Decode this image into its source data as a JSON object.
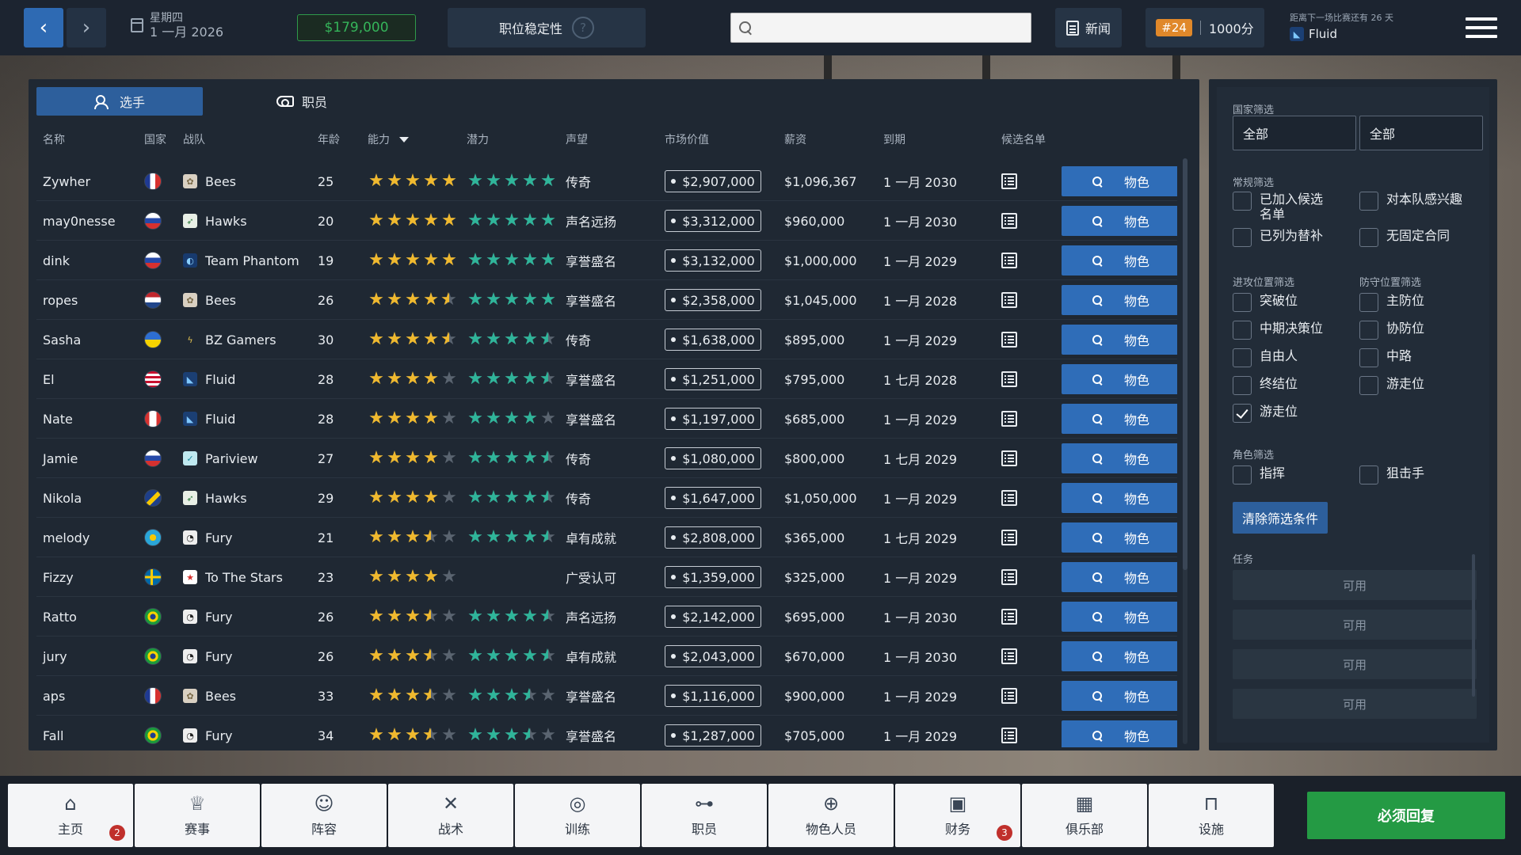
{
  "topbar": {
    "weekday": "星期四",
    "date": "1 一月 2026",
    "balance": "$179,000",
    "job_security_label": "职位稳定性",
    "job_security_help": "?",
    "search": {
      "value": "",
      "placeholder": ""
    },
    "news_label": "新闻",
    "rank_badge": "#24",
    "points": "1000分",
    "next_match_label": "距离下一场比赛还有 26 天",
    "next_match_team": "Fluid"
  },
  "tabs": [
    {
      "label": "选手",
      "icon": "players-icon",
      "active": true
    },
    {
      "label": "职员",
      "icon": "whistle-icon",
      "active": false
    }
  ],
  "table": {
    "headers": {
      "name": "名称",
      "nationality": "国家",
      "team": "战队",
      "age": "年龄",
      "ability": "能力",
      "potential": "潜力",
      "reputation": "声望",
      "market_value": "市场价值",
      "salary": "薪资",
      "expiry": "到期",
      "shortlist": "候选名单"
    },
    "scout_label": "物色",
    "rows": [
      {
        "name": "Zywher",
        "flag": "france",
        "team": "Bees",
        "age": "25",
        "ability": 5,
        "potential": 5,
        "reputation": "传奇",
        "value": "$2,907,000",
        "salary": "$1,096,367",
        "expiry": "1 一月 2030"
      },
      {
        "name": "may0nesse",
        "flag": "russia",
        "team": "Hawks",
        "age": "20",
        "ability": 5,
        "potential": 5,
        "reputation": "声名远扬",
        "value": "$3,312,000",
        "salary": "$960,000",
        "expiry": "1 一月 2030"
      },
      {
        "name": "dink",
        "flag": "russia",
        "team": "Team Phantom",
        "age": "19",
        "ability": 5,
        "potential": 5,
        "reputation": "享誉盛名",
        "value": "$3,132,000",
        "salary": "$1,000,000",
        "expiry": "1 一月 2029"
      },
      {
        "name": "ropes",
        "flag": "netherlands",
        "team": "Bees",
        "age": "26",
        "ability": 4.5,
        "potential": 5,
        "reputation": "享誉盛名",
        "value": "$2,358,000",
        "salary": "$1,045,000",
        "expiry": "1 一月 2028"
      },
      {
        "name": "Sasha",
        "flag": "ukraine",
        "team": "BZ Gamers",
        "age": "30",
        "ability": 4.5,
        "potential": 4.5,
        "reputation": "传奇",
        "value": "$1,638,000",
        "salary": "$895,000",
        "expiry": "1 一月 2029"
      },
      {
        "name": "El",
        "flag": "usa",
        "team": "Fluid",
        "age": "28",
        "ability": 4,
        "potential": 4.5,
        "reputation": "享誉盛名",
        "value": "$1,251,000",
        "salary": "$795,000",
        "expiry": "1 七月 2028"
      },
      {
        "name": "Nate",
        "flag": "canada",
        "team": "Fluid",
        "age": "28",
        "ability": 4,
        "potential": 4,
        "reputation": "享誉盛名",
        "value": "$1,197,000",
        "salary": "$685,000",
        "expiry": "1 一月 2029"
      },
      {
        "name": "Jamie",
        "flag": "russia",
        "team": "Pariview",
        "age": "27",
        "ability": 4,
        "potential": 4.5,
        "reputation": "传奇",
        "value": "$1,080,000",
        "salary": "$800,000",
        "expiry": "1 七月 2029"
      },
      {
        "name": "Nikola",
        "flag": "bosnia",
        "team": "Hawks",
        "age": "29",
        "ability": 4,
        "potential": 4.5,
        "reputation": "传奇",
        "value": "$1,647,000",
        "salary": "$1,050,000",
        "expiry": "1 一月 2029"
      },
      {
        "name": "melody",
        "flag": "kazakhstan",
        "team": "Fury",
        "age": "21",
        "ability": 3.5,
        "potential": 4.5,
        "reputation": "卓有成就",
        "value": "$2,808,000",
        "salary": "$365,000",
        "expiry": "1 七月 2029"
      },
      {
        "name": "Fizzy",
        "flag": "sweden",
        "team": "To The Stars",
        "age": "23",
        "ability": 4,
        "potential": 0,
        "reputation": "广受认可",
        "value": "$1,359,000",
        "salary": "$325,000",
        "expiry": "1 一月 2029"
      },
      {
        "name": "Ratto",
        "flag": "brazil",
        "team": "Fury",
        "age": "26",
        "ability": 3.5,
        "potential": 4.5,
        "reputation": "声名远扬",
        "value": "$2,142,000",
        "salary": "$695,000",
        "expiry": "1 一月 2030"
      },
      {
        "name": "jury",
        "flag": "brazil",
        "team": "Fury",
        "age": "26",
        "ability": 3.5,
        "potential": 4.5,
        "reputation": "卓有成就",
        "value": "$2,043,000",
        "salary": "$670,000",
        "expiry": "1 一月 2030"
      },
      {
        "name": "aps",
        "flag": "france",
        "team": "Bees",
        "age": "33",
        "ability": 3.5,
        "potential": 3.5,
        "reputation": "享誉盛名",
        "value": "$1,116,000",
        "salary": "$900,000",
        "expiry": "1 一月 2029"
      },
      {
        "name": "Fall",
        "flag": "brazil",
        "team": "Fury",
        "age": "34",
        "ability": 3.5,
        "potential": 3.5,
        "reputation": "享誉盛名",
        "value": "$1,287,000",
        "salary": "$705,000",
        "expiry": "1 一月 2029"
      }
    ]
  },
  "filters": {
    "country_label": "国家筛选",
    "country_select_1": "全部",
    "country_select_2": "全部",
    "general_label": "常规筛选",
    "general": [
      {
        "label": "已加入候选名单",
        "checked": false
      },
      {
        "label": "对本队感兴趣",
        "checked": false
      },
      {
        "label": "已列为替补",
        "checked": false
      },
      {
        "label": "无固定合同",
        "checked": false
      }
    ],
    "attack_label": "进攻位置筛选",
    "attack": [
      {
        "label": "突破位",
        "checked": false
      },
      {
        "label": "中期决策位",
        "checked": false
      },
      {
        "label": "自由人",
        "checked": false
      },
      {
        "label": "终结位",
        "checked": false
      },
      {
        "label": "游走位",
        "checked": true
      }
    ],
    "defense_label": "防守位置筛选",
    "defense": [
      {
        "label": "主防位",
        "checked": false
      },
      {
        "label": "协防位",
        "checked": false
      },
      {
        "label": "中路",
        "checked": false
      },
      {
        "label": "游走位",
        "checked": false
      }
    ],
    "role_label": "角色筛选",
    "roles": [
      {
        "label": "指挥",
        "checked": false
      },
      {
        "label": "狙击手",
        "checked": false
      }
    ],
    "clear_label": "清除筛选条件",
    "tasks_label": "任务",
    "tasks": [
      "可用",
      "可用",
      "可用",
      "可用"
    ]
  },
  "bottom_nav": {
    "items": [
      {
        "label": "主页",
        "icon": "home-icon",
        "badge": "2"
      },
      {
        "label": "赛事",
        "icon": "trophy-icon",
        "badge": ""
      },
      {
        "label": "阵容",
        "icon": "squad-icon",
        "badge": ""
      },
      {
        "label": "战术",
        "icon": "tactics-icon",
        "badge": ""
      },
      {
        "label": "训练",
        "icon": "training-icon",
        "badge": ""
      },
      {
        "label": "职员",
        "icon": "whistle-icon",
        "badge": ""
      },
      {
        "label": "物色人员",
        "icon": "scouting-icon",
        "badge": ""
      },
      {
        "label": "财务",
        "icon": "finance-icon",
        "badge": "3"
      },
      {
        "label": "俱乐部",
        "icon": "club-icon",
        "badge": ""
      },
      {
        "label": "设施",
        "icon": "facilities-icon",
        "badge": ""
      }
    ],
    "must_reply_label": "必须回复"
  },
  "colors": {
    "accent_blue": "#2f6db8",
    "star_gold": "#f0b92e",
    "star_green": "#2fb59a",
    "money_green": "#35b45a",
    "reply_green": "#249a44",
    "rank_orange": "#e0882a"
  }
}
